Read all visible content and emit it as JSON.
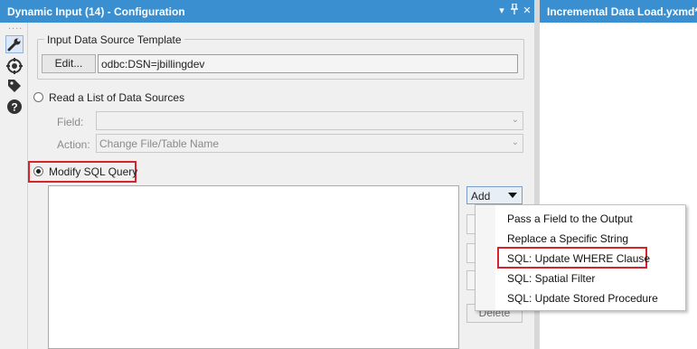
{
  "window": {
    "title": "Dynamic Input (14) - Configuration",
    "controls": {
      "dropdown_glyph": "▾",
      "pin_glyph": "📌",
      "close_glyph": "✕"
    }
  },
  "right_panel": {
    "tab_title": "Incremental Data Load.yxmd*"
  },
  "sidebar": {
    "grip": "....",
    "icons": [
      "wrench-icon",
      "target-icon",
      "tag-icon",
      "help-icon"
    ]
  },
  "template_group": {
    "legend": "Input Data Source Template",
    "edit_button": "Edit...",
    "connection_value": "odbc:DSN=jbillingdev"
  },
  "read_list": {
    "label": "Read a List of Data Sources",
    "field_label": "Field:",
    "field_value": "",
    "action_label": "Action:",
    "action_value": "Change File/Table Name"
  },
  "modify_sql": {
    "label": "Modify SQL Query",
    "selected": true,
    "add_button": "Add",
    "delete_button": "Delete"
  },
  "add_menu": {
    "items": [
      "Pass a Field to the Output",
      "Replace a Specific String",
      "SQL: Update WHERE Clause",
      "SQL: Spatial Filter",
      "SQL: Update Stored Procedure"
    ],
    "highlighted_index": 2
  },
  "colors": {
    "title_bar": "#3a8fd0",
    "highlight_border": "#d9232a"
  }
}
